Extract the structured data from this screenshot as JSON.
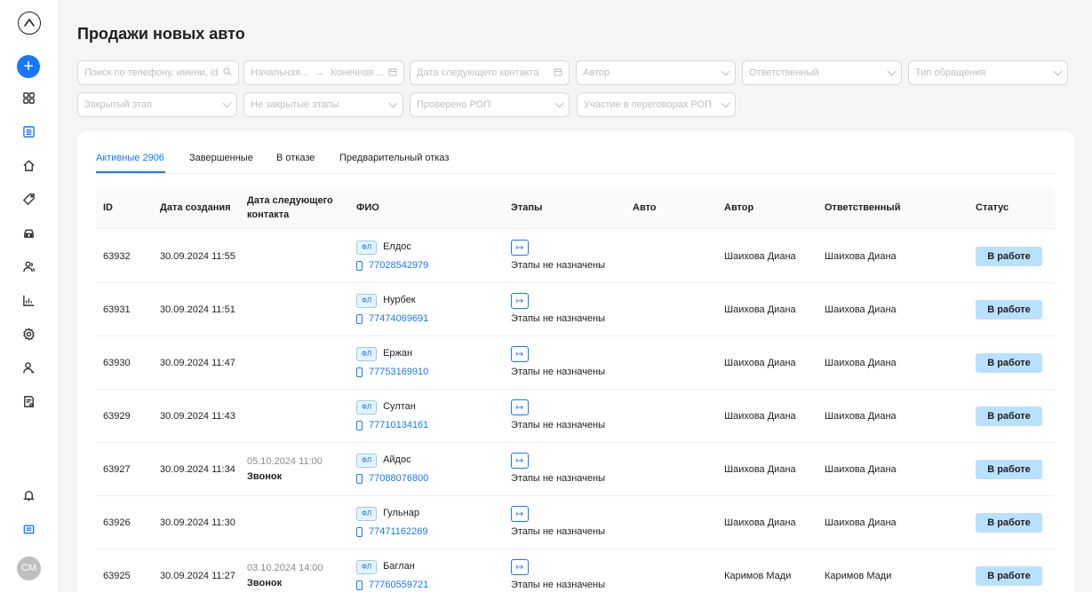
{
  "sidebar": {
    "icons": [
      "logo-icon",
      "add-icon",
      "grid-icon",
      "list-icon",
      "home-icon",
      "tag-icon",
      "car-icon",
      "users-icon",
      "chart-icon",
      "gear-icon",
      "user-icon",
      "report-icon",
      "bell-icon",
      "book-icon"
    ],
    "avatar": "CM"
  },
  "page": {
    "title": "Продажи новых авто"
  },
  "filters": {
    "search": "Поиск по телефону, имени, id",
    "date_start": "Начальная...",
    "date_arrow": "→",
    "date_end": "Конечная ...",
    "next_contact_date": "Дата следующего контакта",
    "author": "Автор",
    "responsible": "Ответственный",
    "request_type": "Тип обращения",
    "closed_stage": "Закрытый этап",
    "not_closed_stages": "Не закрытые этапы",
    "checked_rop": "Проверено РОП",
    "rop_participation": "Участие в переговорах РОП"
  },
  "tabs": [
    {
      "label": "Активные 2906",
      "active": true
    },
    {
      "label": "Завершенные"
    },
    {
      "label": "В отказе"
    },
    {
      "label": "Предварительный отказ"
    }
  ],
  "table": {
    "columns": [
      "ID",
      "Дата создания",
      "Дата следующего контакта",
      "ФИО",
      "Этапы",
      "Авто",
      "Автор",
      "Ответственный",
      "Статус"
    ],
    "rows": [
      {
        "id": "63932",
        "created": "30.09.2024 11:55",
        "next_date": "",
        "next_kind": "",
        "type": "ФЛ",
        "name": "Елдос",
        "phone": "77028542979",
        "stages": "Этапы не назначены",
        "auto": "",
        "author": "Шаихова Диана",
        "responsible": "Шаихова Диана",
        "status": "В работе"
      },
      {
        "id": "63931",
        "created": "30.09.2024 11:51",
        "next_date": "",
        "next_kind": "",
        "type": "ФЛ",
        "name": "Нурбек",
        "phone": "77474069691",
        "stages": "Этапы не назначены",
        "auto": "",
        "author": "Шаихова Диана",
        "responsible": "Шаихова Диана",
        "status": "В работе"
      },
      {
        "id": "63930",
        "created": "30.09.2024 11:47",
        "next_date": "",
        "next_kind": "",
        "type": "ФЛ",
        "name": "Ержан",
        "phone": "77753169910",
        "stages": "Этапы не назначены",
        "auto": "",
        "author": "Шаихова Диана",
        "responsible": "Шаихова Диана",
        "status": "В работе"
      },
      {
        "id": "63929",
        "created": "30.09.2024 11:43",
        "next_date": "",
        "next_kind": "",
        "type": "ФЛ",
        "name": "Султан",
        "phone": "77710134161",
        "stages": "Этапы не назначены",
        "auto": "",
        "author": "Шаихова Диана",
        "responsible": "Шаихова Диана",
        "status": "В работе"
      },
      {
        "id": "63927",
        "created": "30.09.2024 11:34",
        "next_date": "05.10.2024 11:00",
        "next_kind": "Звонок",
        "type": "ФЛ",
        "name": "Айдос",
        "phone": "77088076800",
        "stages": "Этапы не назначены",
        "auto": "",
        "author": "Шаихова Диана",
        "responsible": "Шаихова Диана",
        "status": "В работе"
      },
      {
        "id": "63926",
        "created": "30.09.2024 11:30",
        "next_date": "",
        "next_kind": "",
        "type": "ФЛ",
        "name": "Гульнар",
        "phone": "77471162269",
        "stages": "Этапы не назначены",
        "auto": "",
        "author": "Шаихова Диана",
        "responsible": "Шаихова Диана",
        "status": "В работе"
      },
      {
        "id": "63925",
        "created": "30.09.2024 11:27",
        "next_date": "03.10.2024 14:00",
        "next_kind": "Звонок",
        "type": "ФЛ",
        "name": "Баглан",
        "phone": "77760559721",
        "stages": "Этапы не назначены",
        "auto": "",
        "author": "Каримов Мади",
        "responsible": "Каримов Мади",
        "status": "В работе"
      }
    ]
  },
  "colors": {
    "accent": "#1677ff",
    "status_bg": "#bae0ff"
  }
}
